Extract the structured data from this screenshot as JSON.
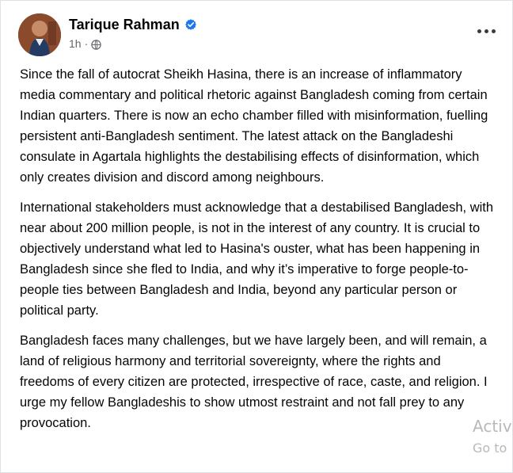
{
  "post": {
    "author": "Tarique Rahman",
    "time": "1h",
    "separator": "·",
    "paragraphs": [
      "Since the fall of autocrat Sheikh Hasina, there is an increase of inflammatory media commentary and political rhetoric against Bangladesh coming from certain Indian quarters. There is now an echo chamber filled with misinformation, fuelling persistent anti-Bangladesh sentiment. The latest attack on the Bangladeshi consulate in Agartala highlights the destabilising effects of disinformation, which only creates division and discord among neighbours.",
      "International stakeholders must acknowledge that a destabilised Bangladesh, with near about 200 million people, is not in the interest of any country. It is crucial to objectively understand what led to Hasina's ouster, what has been happening in Bangladesh since she fled to India, and why it’s imperative to forge people-to-people ties between Bangladesh and India, beyond any particular person or political party.",
      "Bangladesh faces many challenges, but we have largely been, and will remain, a land of religious harmony and territorial sovereignty, where the rights and freedoms of every citizen are protected, irrespective of race, caste, and religion. I urge my fellow Bangladeshis to show utmost restraint and not fall prey to any provocation."
    ]
  },
  "watermark": {
    "line1": "Activ",
    "line2": "Go to"
  },
  "icons": {
    "verified": "verified-badge-icon",
    "privacy": "globe-icon",
    "more": "more-options-icon"
  },
  "colors": {
    "verified": "#1877f2",
    "text": "#050505",
    "secondary": "#65676b"
  }
}
